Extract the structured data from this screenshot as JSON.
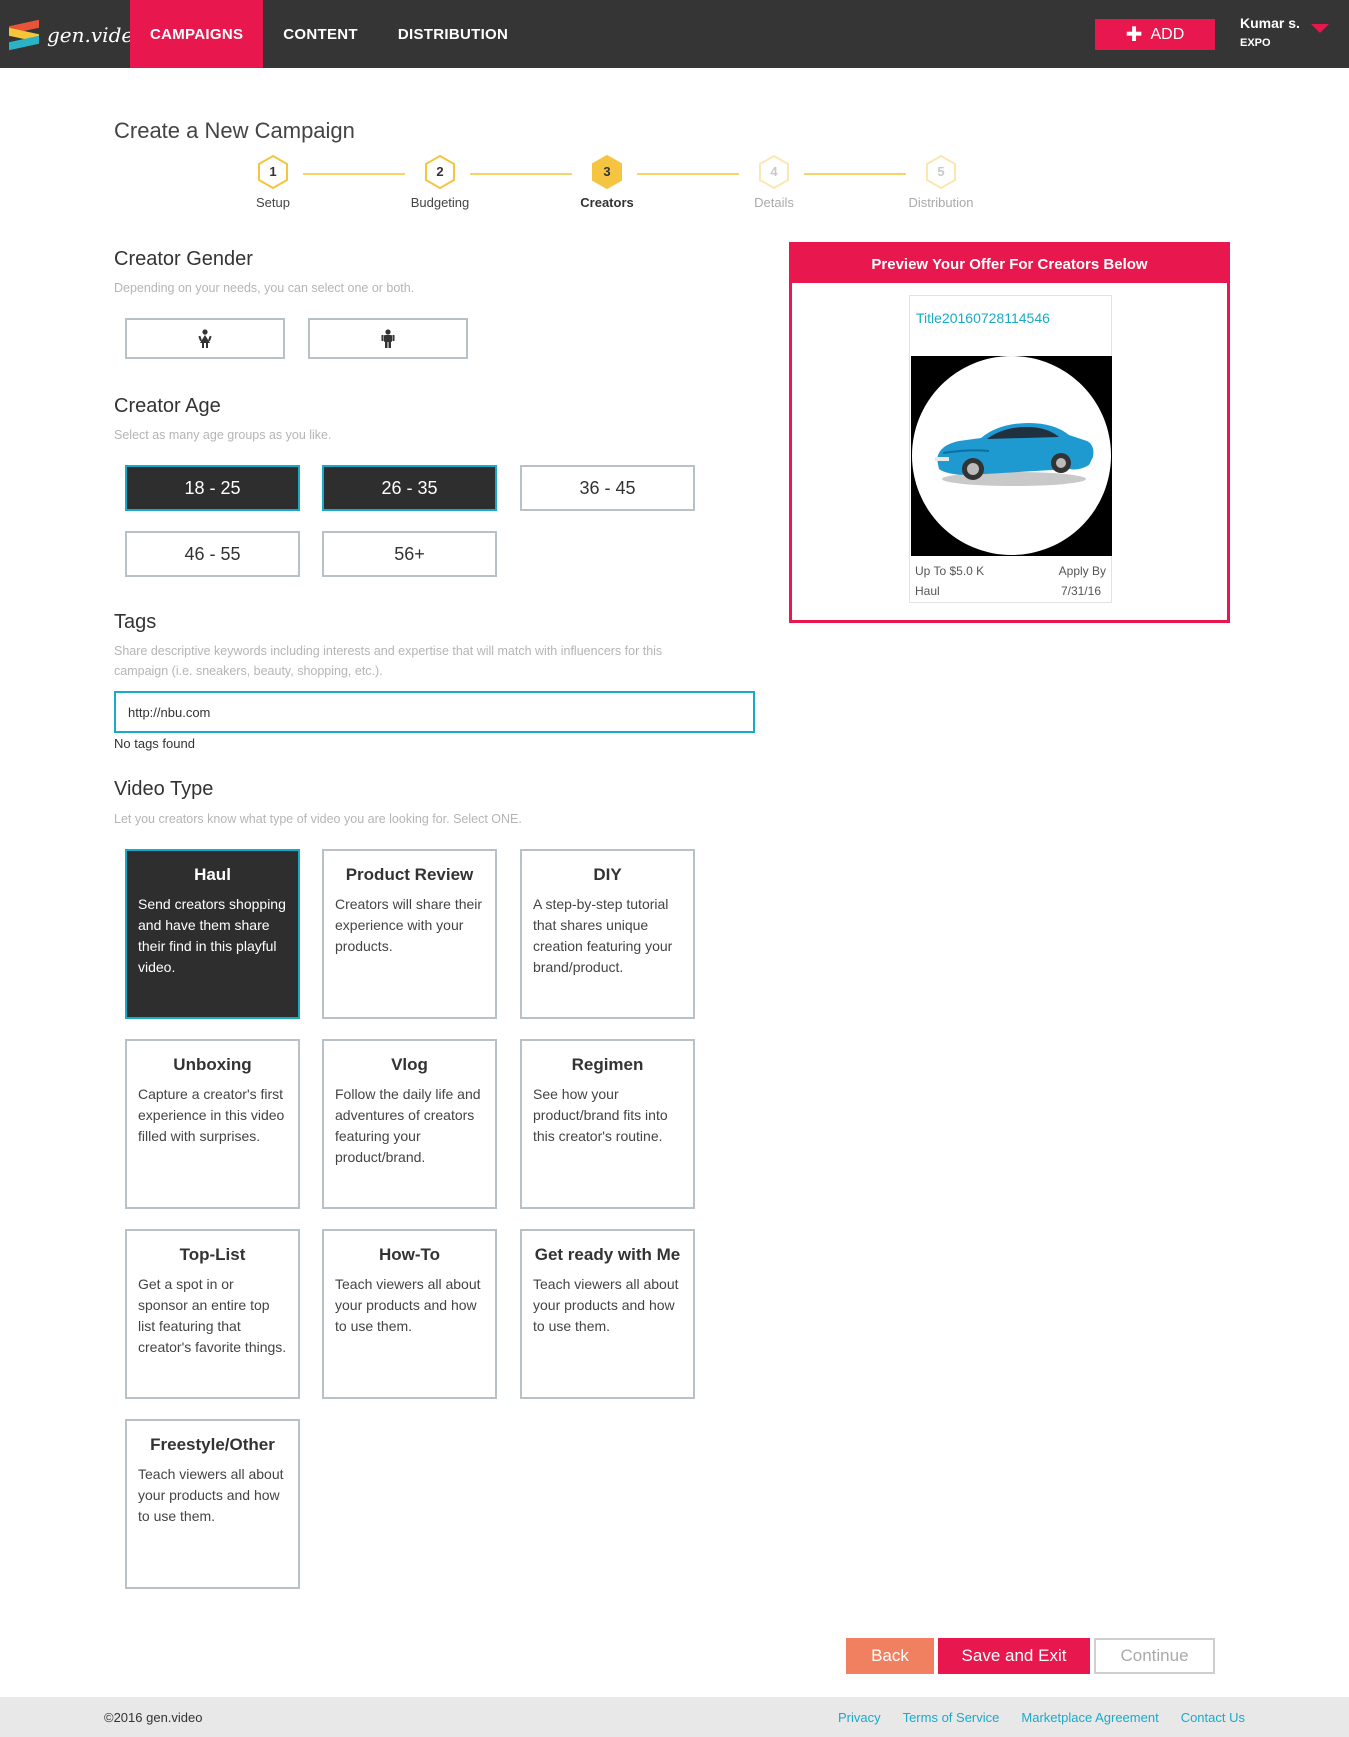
{
  "header": {
    "logo_text": "gen.video",
    "nav": [
      {
        "label": "CAMPAIGNS",
        "active": true
      },
      {
        "label": "CONTENT",
        "active": false
      },
      {
        "label": "DISTRIBUTION",
        "active": false
      }
    ],
    "add_label": "ADD",
    "user_name": "Kumar s.",
    "user_org": "EXPO",
    "accent_color": "#e8174d"
  },
  "page_title": "Create a New Campaign",
  "stepper": {
    "steps": [
      {
        "num": "1",
        "label": "Setup",
        "state": "done"
      },
      {
        "num": "2",
        "label": "Budgeting",
        "state": "done"
      },
      {
        "num": "3",
        "label": "Creators",
        "state": "current"
      },
      {
        "num": "4",
        "label": "Details",
        "state": "pending"
      },
      {
        "num": "5",
        "label": "Distribution",
        "state": "pending"
      }
    ]
  },
  "gender": {
    "title": "Creator Gender",
    "subtitle": "Depending on your needs, you can select one or both.",
    "options": [
      {
        "icon": "female-icon",
        "selected": false
      },
      {
        "icon": "male-icon",
        "selected": false
      }
    ]
  },
  "age": {
    "title": "Creator Age",
    "subtitle": "Select as many age groups as you like.",
    "options": [
      {
        "label": "18 - 25",
        "selected": true
      },
      {
        "label": "26 - 35",
        "selected": true
      },
      {
        "label": "36 - 45",
        "selected": false
      },
      {
        "label": "46 - 55",
        "selected": false
      },
      {
        "label": "56+",
        "selected": false
      }
    ]
  },
  "tags": {
    "title": "Tags",
    "subtitle_line1": "Share descriptive keywords including interests and expertise that will match with influencers for this",
    "subtitle_line2": "campaign (i.e. sneakers, beauty, shopping, etc.).",
    "value": "http://nbu.com",
    "status": "No tags found"
  },
  "video_type": {
    "title": "Video Type",
    "subtitle": "Let you creators know what type of video you are looking for. Select ONE.",
    "options": [
      {
        "title": "Haul",
        "desc": "Send creators shopping and have them share their find in this playful video.",
        "selected": true
      },
      {
        "title": "Product Review",
        "desc": "Creators will share their experience with your products.",
        "selected": false
      },
      {
        "title": "DIY",
        "desc": "A step-by-step tutorial that shares unique creation featuring your brand/product.",
        "selected": false
      },
      {
        "title": "Unboxing",
        "desc": "Capture a creator's first experience in this video filled with surprises.",
        "selected": false
      },
      {
        "title": "Vlog",
        "desc": "Follow the daily life and adventures of creators featuring your product/brand.",
        "selected": false
      },
      {
        "title": "Regimen",
        "desc": "See how your product/brand fits into this creator's routine.",
        "selected": false
      },
      {
        "title": "Top-List",
        "desc": "Get a spot in or sponsor an entire top list featuring that creator's favorite things.",
        "selected": false
      },
      {
        "title": "How-To",
        "desc": "Teach viewers all about your products and how to use them.",
        "selected": false
      },
      {
        "title": "Get ready with Me",
        "desc": "Teach viewers all about your products and how to use them.",
        "selected": false
      },
      {
        "title": "Freestyle/Other",
        "desc": "Teach viewers all about your products and how to use them.",
        "selected": false
      }
    ]
  },
  "preview": {
    "heading": "Preview Your Offer For Creators Below",
    "card_title": "Title20160728114546",
    "budget": "Up To $5.0 K",
    "type": "Haul",
    "apply_label": "Apply By",
    "apply_date": "7/31/16"
  },
  "actions": {
    "back": "Back",
    "save": "Save and Exit",
    "continue": "Continue"
  },
  "footer": {
    "copyright": "©2016 gen.video",
    "links": [
      "Privacy",
      "Terms of Service",
      "Marketplace Agreement",
      "Contact Us"
    ]
  }
}
